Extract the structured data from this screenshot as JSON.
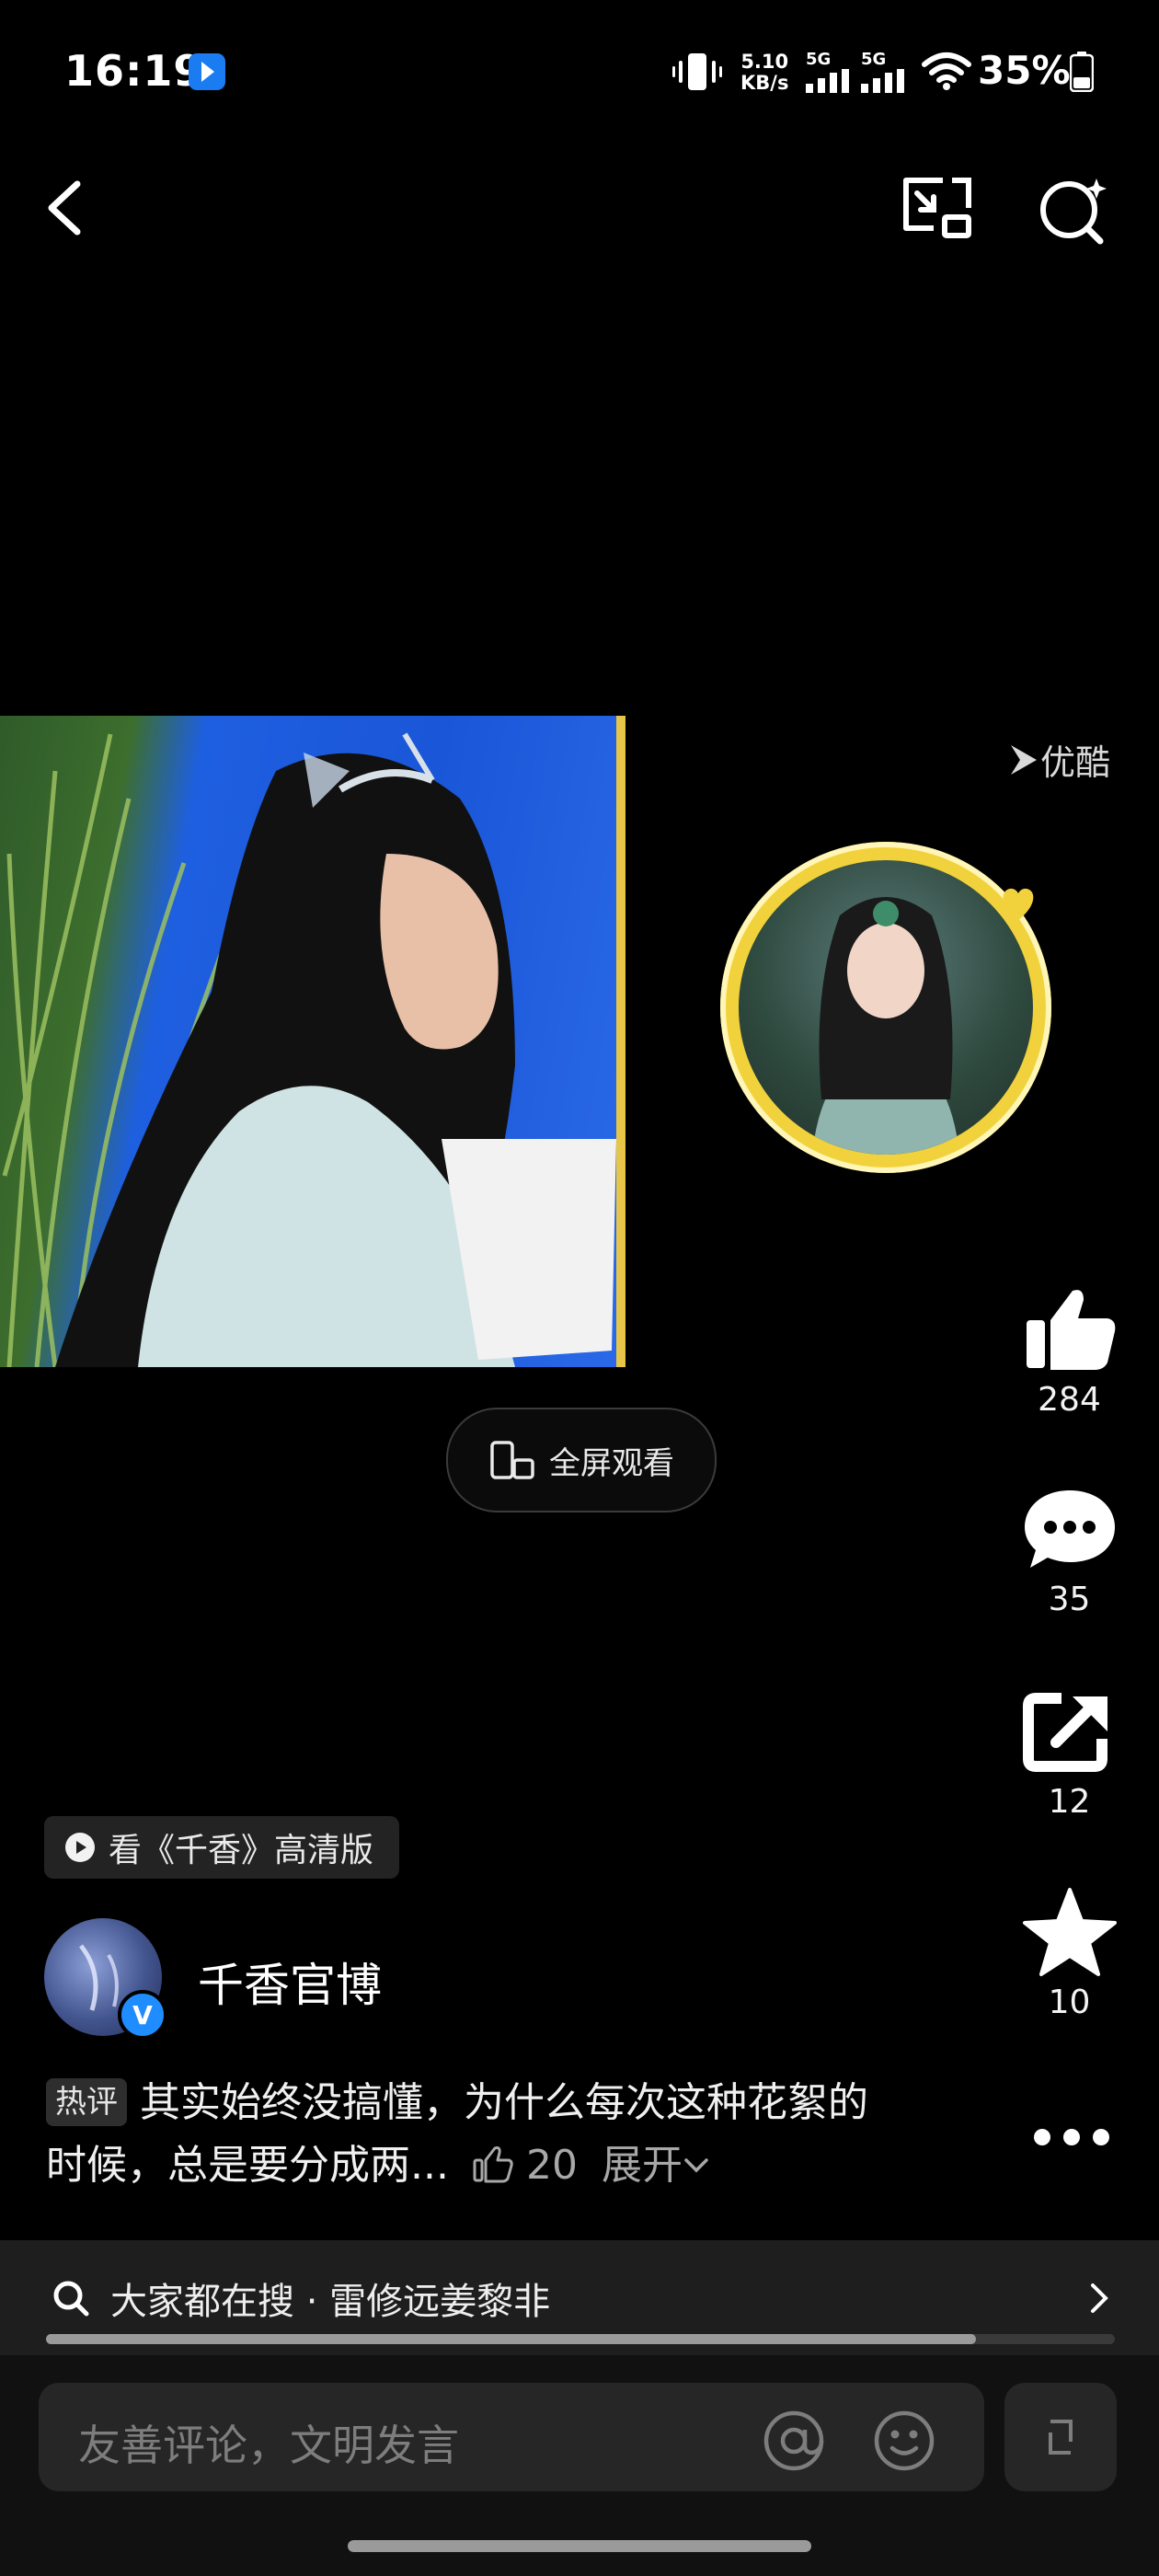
{
  "status_bar": {
    "time": "16:19",
    "net_speed_value": "5.10",
    "net_speed_unit": "KB/s",
    "signal1_label": "5G",
    "signal2_label": "5G",
    "battery_text": "35%"
  },
  "topbar": {
    "back_icon": "chevron-left-icon",
    "pip_icon": "picture-in-picture-icon",
    "search_icon": "search-sparkle-icon"
  },
  "video": {
    "watermark": "优酷"
  },
  "fullscreen": {
    "label": "全屏观看"
  },
  "actions": {
    "like_count": "284",
    "comment_count": "35",
    "share_count": "12",
    "favorite_count": "10"
  },
  "hd_tag": {
    "label": "看《千香》高清版"
  },
  "author": {
    "name": "千香官博",
    "verified_mark": "V"
  },
  "hot_comment": {
    "badge": "热评",
    "text": "其实始终没搞懂，为什么每次这种花絮的时候，总是要分成两...",
    "likes": "20",
    "expand": "展开"
  },
  "search_strip": {
    "text": "大家都在搜 · 雷修远姜黎非",
    "progress": 0.87
  },
  "comment_input": {
    "placeholder": "友善评论，文明发言"
  },
  "colors": {
    "background": "#000000",
    "accent": "#1f8cff",
    "ring": "#f2d23c"
  }
}
